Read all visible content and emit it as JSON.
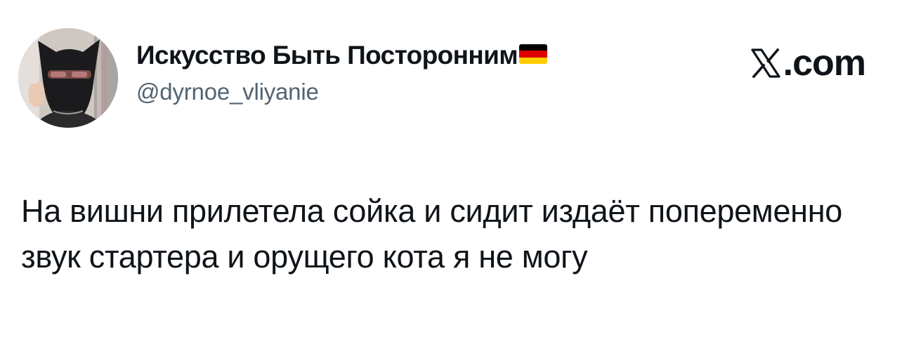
{
  "author": {
    "display_name": "Искусство Быть Посторонним",
    "handle": "@dyrnoe_vliyanie",
    "avatar_icon": "avatar-photo",
    "flag_icon": "germany-flag-icon",
    "flag_colors": [
      "#000000",
      "#dd0000",
      "#ffce00"
    ]
  },
  "brand": {
    "text": ".com",
    "icon": "x-logo-icon"
  },
  "tweet": {
    "text": "На вишни прилетела сойка и сидит издаёт попеременно звук стартера и орущего кота я не могу"
  }
}
